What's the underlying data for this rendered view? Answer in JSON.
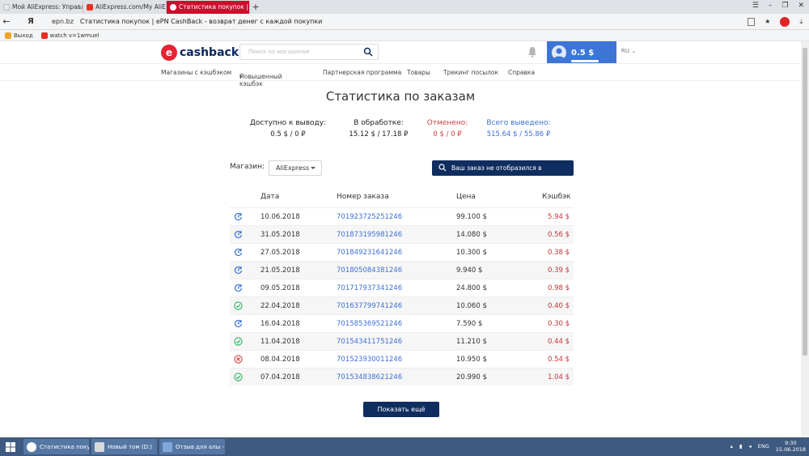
{
  "browser": {
    "tabs": [
      {
        "label": "Мой AliExpress: Управлять",
        "active": false,
        "color": "#e8e8e8"
      },
      {
        "label": "AliExpress.com/My AliExpre",
        "active": false,
        "color": "#e43225"
      },
      {
        "label": "Статистика покупок | ePN",
        "active": true,
        "color": "#ffffff"
      }
    ],
    "new_tab": "+",
    "url": "epn.bz",
    "page_title": "Статистика покупок | ePN CashBack - возврат денег с каждой покупки",
    "bookmarks": [
      {
        "label": "Выход",
        "color": "#f3a325"
      },
      {
        "label": "watch v=1wmuel",
        "color": "#e52d27"
      }
    ]
  },
  "site": {
    "logo_text": "cashback",
    "logo_mark": "e",
    "search_placeholder": "Поиск по магазинам",
    "balance": "0.5 $",
    "lang": "RU",
    "nav": [
      "Магазины с кэшбэком",
      "Повышенный кэшбэк",
      "Партнерская программа",
      "Товары",
      "Трекинг посылок",
      "Справка"
    ],
    "brand_color": "#0f2d5f",
    "accent_color": "#3d75d6"
  },
  "page": {
    "title": "Статистика по заказам",
    "stats": [
      {
        "label": "Доступно к выводу:",
        "value": "0.5 $ / 0 ₽",
        "color": "#333333"
      },
      {
        "label": "В обработке:",
        "value": "15.12 $ / 17.18 ₽",
        "color": "#222222"
      },
      {
        "label": "Отменено:",
        "value": "0 $ / 0 ₽",
        "color": "#d23c3c"
      },
      {
        "label": "Всего выведено:",
        "value": "515.64 $ / 55.86 ₽",
        "color": "#3d6fd1"
      }
    ],
    "shop_label": "Магазин:",
    "shop_value": "AliExpress",
    "missing_order_button": "Ваш заказ не отобразился в статистике?",
    "columns": [
      "Дата",
      "Номер заказа",
      "Цена",
      "Кэшбэк"
    ],
    "rows": [
      {
        "status": "pending",
        "date": "10.06.2018",
        "order": "701923725251246",
        "price": "99.100 $",
        "cashback": "5.94 $"
      },
      {
        "status": "pending",
        "date": "31.05.2018",
        "order": "701873195981246",
        "price": "14.080 $",
        "cashback": "0.56 $"
      },
      {
        "status": "pending",
        "date": "27.05.2018",
        "order": "701849231641246",
        "price": "10.300 $",
        "cashback": "0.38 $"
      },
      {
        "status": "pending",
        "date": "21.05.2018",
        "order": "701805084381246",
        "price": "9.940 $",
        "cashback": "0.39 $"
      },
      {
        "status": "pending",
        "date": "09.05.2018",
        "order": "701717937341246",
        "price": "24.800 $",
        "cashback": "0.98 $"
      },
      {
        "status": "approved",
        "date": "22.04.2018",
        "order": "701637799741246",
        "price": "10.060 $",
        "cashback": "0.40 $"
      },
      {
        "status": "pending",
        "date": "16.04.2018",
        "order": "701585369521246",
        "price": "7.590 $",
        "cashback": "0.30 $"
      },
      {
        "status": "approved",
        "date": "11.04.2018",
        "order": "701543411751246",
        "price": "11.210 $",
        "cashback": "0.44 $"
      },
      {
        "status": "cancelled",
        "date": "08.04.2018",
        "order": "701523930011246",
        "price": "10.950 $",
        "cashback": "0.54 $"
      },
      {
        "status": "approved",
        "date": "07.04.2018",
        "order": "701534838621246",
        "price": "20.990 $",
        "cashback": "1.04 $"
      }
    ],
    "more_button": "Показать ещё"
  },
  "taskbar": {
    "items": [
      {
        "label": "Статистика покуп...",
        "color": "#ffffff"
      },
      {
        "label": "Новый том (D:)",
        "color": "#d9d9d9"
      },
      {
        "label": "Отзыв для алы - ...",
        "color": "#7fa7d9"
      }
    ],
    "lang": "ENG",
    "time": "9:30",
    "date": "15.06.2018"
  }
}
